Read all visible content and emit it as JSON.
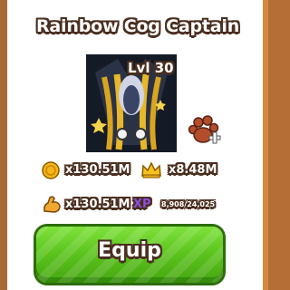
{
  "card": {
    "title": "Rainbow Cog Captain",
    "level": "Lvl 30"
  },
  "stats": {
    "coins_multiplier": "x130.51M",
    "crown_multiplier": "x8.48M",
    "strength_multiplier": "x130.51M",
    "xp_label": "XP",
    "xp_progress": "8,908/24,025"
  },
  "actions": {
    "equip_label": "Equip"
  },
  "colors": {
    "panel_border": "#b56f36",
    "equip_green": "#5ac21c",
    "xp_purple": "#7a3cc8",
    "text_outline": "#4a2e1f"
  },
  "icons": {
    "coin": "coin-icon",
    "crown": "crown-icon",
    "strength": "flexed-arm-icon",
    "feed": "paw-plus-icon"
  }
}
